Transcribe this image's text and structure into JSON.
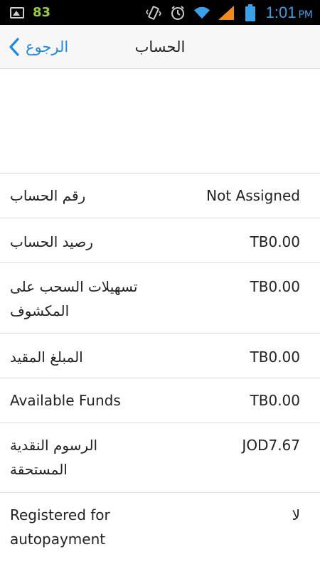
{
  "status_bar": {
    "notification_count": "83",
    "time": "1:01",
    "ampm": "PM",
    "icons": [
      "image-icon",
      "vibrate-icon",
      "alarm-icon",
      "wifi-icon",
      "signal-icon",
      "battery-icon"
    ],
    "colors": {
      "count": "#9ccc3c",
      "time": "#3aa0e8",
      "signal": "#f08a1c"
    }
  },
  "header": {
    "back_label": "الرجوع",
    "title": "الحساب",
    "accent": "#1e88e5"
  },
  "rows": [
    {
      "label": "رقم الحساب",
      "value": "Not Assigned"
    },
    {
      "label": "رصيد الحساب",
      "value": "TB0.00"
    },
    {
      "label": "تسهيلات السحب على المكشوف",
      "value": "TB0.00"
    },
    {
      "label": "المبلغ المقيد",
      "value": "TB0.00"
    },
    {
      "label": "Available Funds",
      "value": "TB0.00"
    },
    {
      "label": "الرسوم النقدية المستحقة",
      "value": "JOD7.67"
    },
    {
      "label": "Registered for autopayment",
      "value": "لا"
    }
  ]
}
